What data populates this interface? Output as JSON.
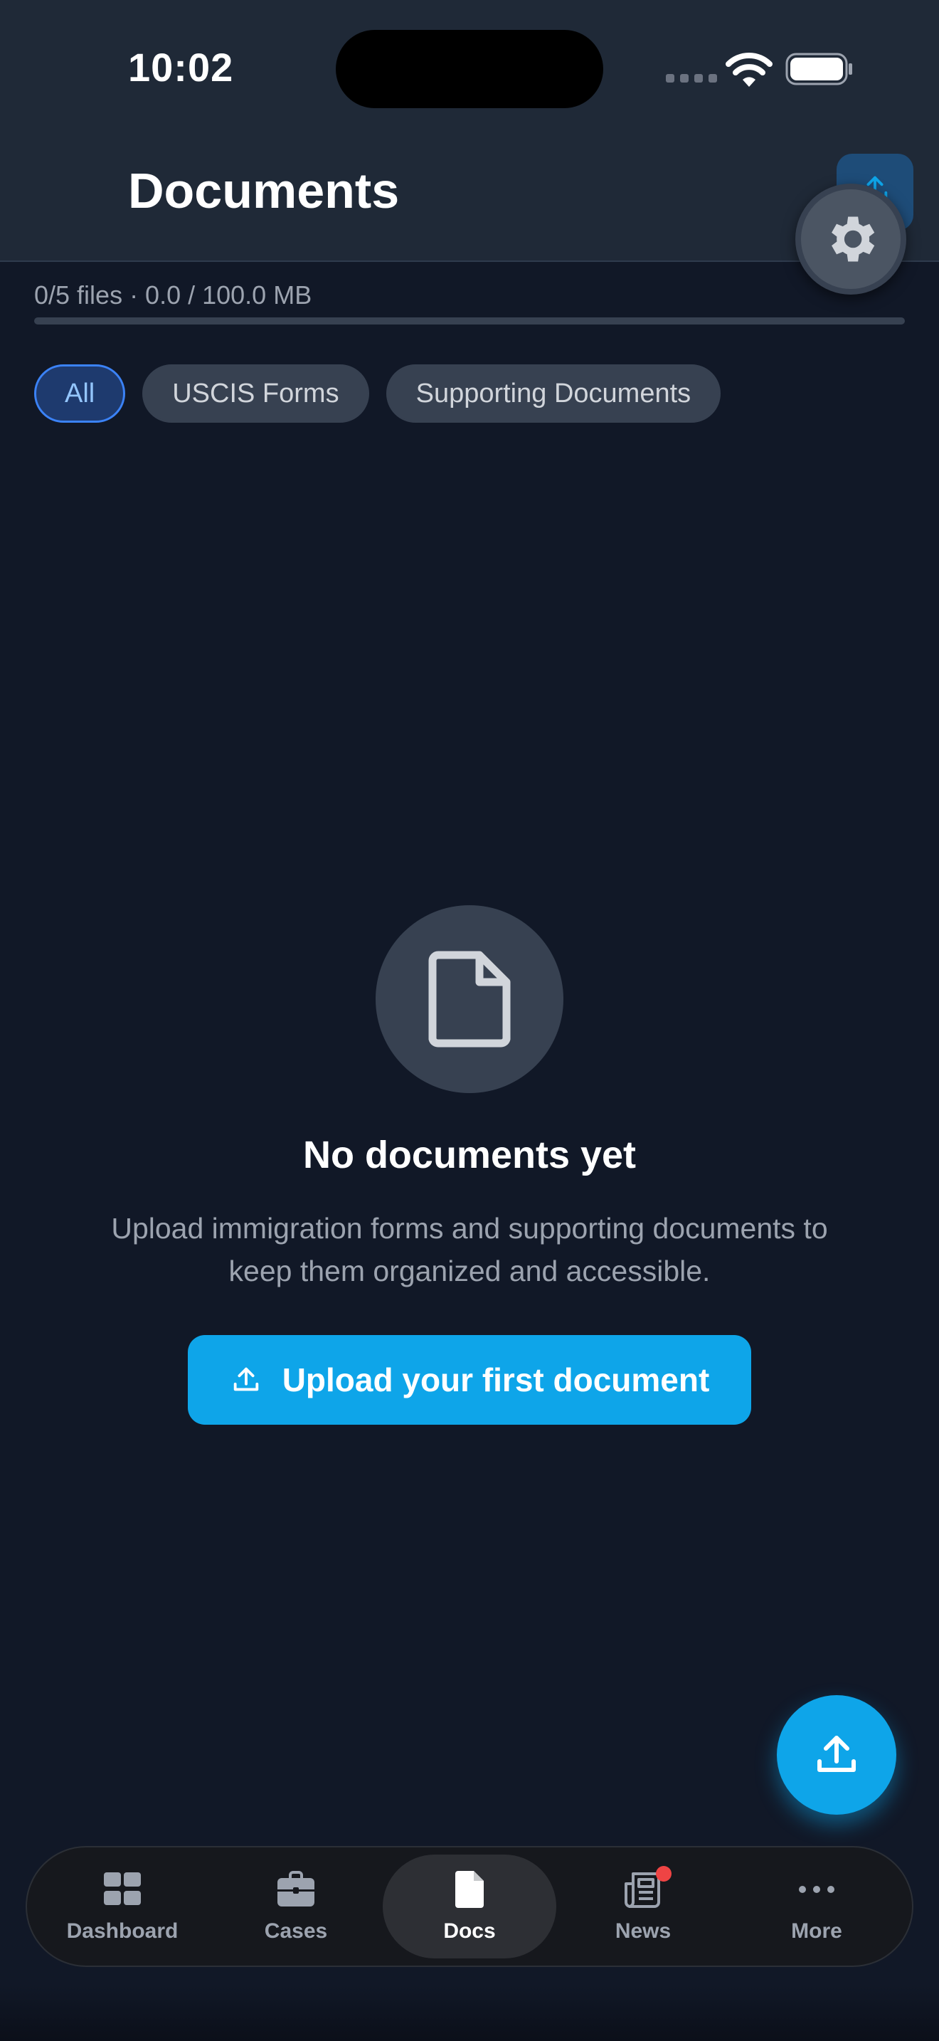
{
  "status_bar": {
    "time": "10:02"
  },
  "header": {
    "title": "Documents",
    "upload_icon": "upload-icon",
    "settings_icon": "gear-icon"
  },
  "storage": {
    "summary": "0/5 files · 0.0 / 100.0 MB",
    "used_fraction": 0.0
  },
  "filters": [
    {
      "label": "All",
      "active": true
    },
    {
      "label": "USCIS Forms",
      "active": false
    },
    {
      "label": "Supporting Documents",
      "active": false
    }
  ],
  "empty_state": {
    "icon": "document-icon",
    "title": "No documents yet",
    "description": "Upload immigration forms and supporting documents to keep them organized and accessible.",
    "button_label": "Upload your first document"
  },
  "fab": {
    "icon": "upload-icon"
  },
  "tabbar": {
    "items": [
      {
        "label": "Dashboard",
        "icon": "grid-icon",
        "active": false
      },
      {
        "label": "Cases",
        "icon": "briefcase-icon",
        "active": false
      },
      {
        "label": "Docs",
        "icon": "document-icon",
        "active": true
      },
      {
        "label": "News",
        "icon": "newspaper-icon",
        "active": false,
        "badge": true
      },
      {
        "label": "More",
        "icon": "more-icon",
        "active": false
      }
    ]
  },
  "colors": {
    "background": "#111827",
    "header": "#1f2937",
    "accent": "#0ea5e9",
    "chip_active_border": "#3b82f6",
    "badge": "#ef4444"
  }
}
